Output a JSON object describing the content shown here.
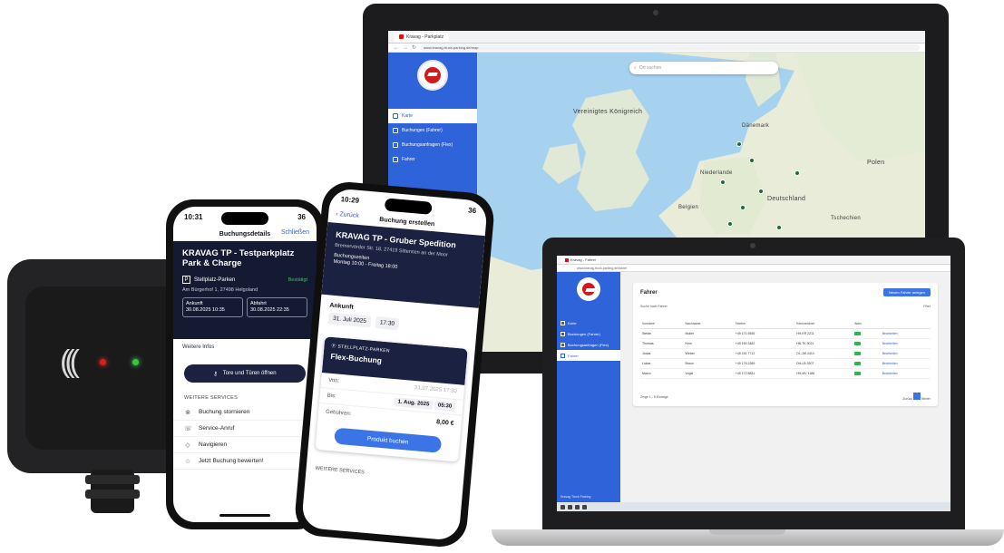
{
  "monitor": {
    "browser": {
      "tab_title": "Kravag - Parkplatz",
      "url": "www.kravag-truck-parking.de/map"
    },
    "sidebar": {
      "items": [
        {
          "label": "Karte",
          "active": true
        },
        {
          "label": "Buchungen (Fahrer)",
          "active": false
        },
        {
          "label": "Buchungsanfragen (Flex)",
          "active": false
        },
        {
          "label": "Fahrer",
          "active": false
        }
      ]
    },
    "map": {
      "search_placeholder": "Ort suchen",
      "labels": [
        "Vereinigtes Königreich",
        "Polen",
        "Deutschland",
        "Dänemark",
        "Niederlande",
        "Belgien",
        "Tschechien"
      ]
    }
  },
  "laptop": {
    "browser": {
      "tab_title": "Kravag - Fahrer",
      "url": "www.kravag-truck-parking.de/fahrer"
    },
    "sidebar": {
      "items": [
        {
          "label": "Karte",
          "active": false
        },
        {
          "label": "Buchungen (Fahrer)",
          "active": false
        },
        {
          "label": "Buchungsanfragen (Flex)",
          "active": false
        },
        {
          "label": "Fahrer",
          "active": true
        }
      ],
      "footer": "Kravag Truck Parking"
    },
    "card": {
      "title": "Fahrer",
      "new_button": "Neuen Fahrer anlegen",
      "filter_left": "Suche nach Fahrer",
      "filter_right": "Filter",
      "columns": [
        "Vorname",
        "Nachname",
        "Telefon",
        "Kennzeichen",
        "Aktiv",
        ""
      ],
      "rows": [
        [
          "Stefan",
          "Muller",
          "+49 171 5545",
          "HH-KR 2211",
          true,
          "Bearbeiten"
        ],
        [
          "Thomas",
          "Kern",
          "+49 160 3482",
          "HB-TK 9021",
          true,
          "Bearbeiten"
        ],
        [
          "Jonas",
          "Weber",
          "+49 151 7712",
          "OL-JW 4410",
          true,
          "Bearbeiten"
        ],
        [
          "Lukas",
          "Braun",
          "+49 176 2289",
          "DH-LB 3307",
          true,
          "Bearbeiten"
        ],
        [
          "Marco",
          "Vogel",
          "+49 172 8831",
          "HH-MV 1186",
          true,
          "Bearbeiten"
        ]
      ],
      "pager_left": "Zeige 1 - 5 Einträge",
      "pager_prev": "Zurück",
      "pager_next": "Weiter"
    }
  },
  "phone1": {
    "status": {
      "time": "10:31",
      "battery": "36"
    },
    "nav": {
      "title": "Buchungsdetails",
      "close": "Schließen"
    },
    "booking": {
      "title": "KRAVAG TP - Testparkplatz Park & Charge",
      "type_badge": "P",
      "type": "Stellplatz-Parken",
      "status": "Bestätigt",
      "address": "Am Bürgerhof 1, 27498 Helgoland",
      "arrival_label": "Ankunft",
      "arrival": "30.08.2025 10:35",
      "departure_label": "Abfahrt",
      "departure": "30.08.2025 22:35"
    },
    "more_info": "Weitere Infos",
    "gate_button": "Tore und Türen öffnen",
    "services_title": "WEITERE SERVICES",
    "services": [
      {
        "icon": "cancel-icon",
        "glyph": "⊗",
        "label": "Buchung stornieren"
      },
      {
        "icon": "phone-icon",
        "glyph": "☏",
        "label": "Service-Anruf"
      },
      {
        "icon": "navigate-icon",
        "glyph": "◇",
        "label": "Navigieren"
      },
      {
        "icon": "star-icon",
        "glyph": "☆",
        "label": "Jetzt Buchung bewerten!"
      }
    ]
  },
  "phone2": {
    "status": {
      "time": "10:29",
      "battery": "36"
    },
    "nav": {
      "title": "Buchung erstellen",
      "back": "Zurück"
    },
    "location": {
      "title": "KRAVAG TP - Gruber Spedition",
      "address": "Bremervörder Str. 18, 27419 Sittensen an der Moor",
      "hours_label": "Buchungszeiten",
      "hours": "Montag 10:00 - Freitag 18:00"
    },
    "arrival_label": "Ankunft",
    "arrival_date": "31. Juli 2025",
    "arrival_time": "17:30",
    "card": {
      "tag": "STELLPLATZ-PARKEN",
      "type": "Flex-Buchung",
      "from_label": "Von:",
      "from_value": "31.07.2025 17:30",
      "to_label": "Bis:",
      "to_date": "1. Aug. 2025",
      "to_time": "05:30",
      "total_label": "Gebühren:",
      "total": "8,00 €",
      "button": "Produkt buchen"
    },
    "footer": "WEITERE SERVICES"
  },
  "device": {
    "nfc_symbol": "((("
  }
}
